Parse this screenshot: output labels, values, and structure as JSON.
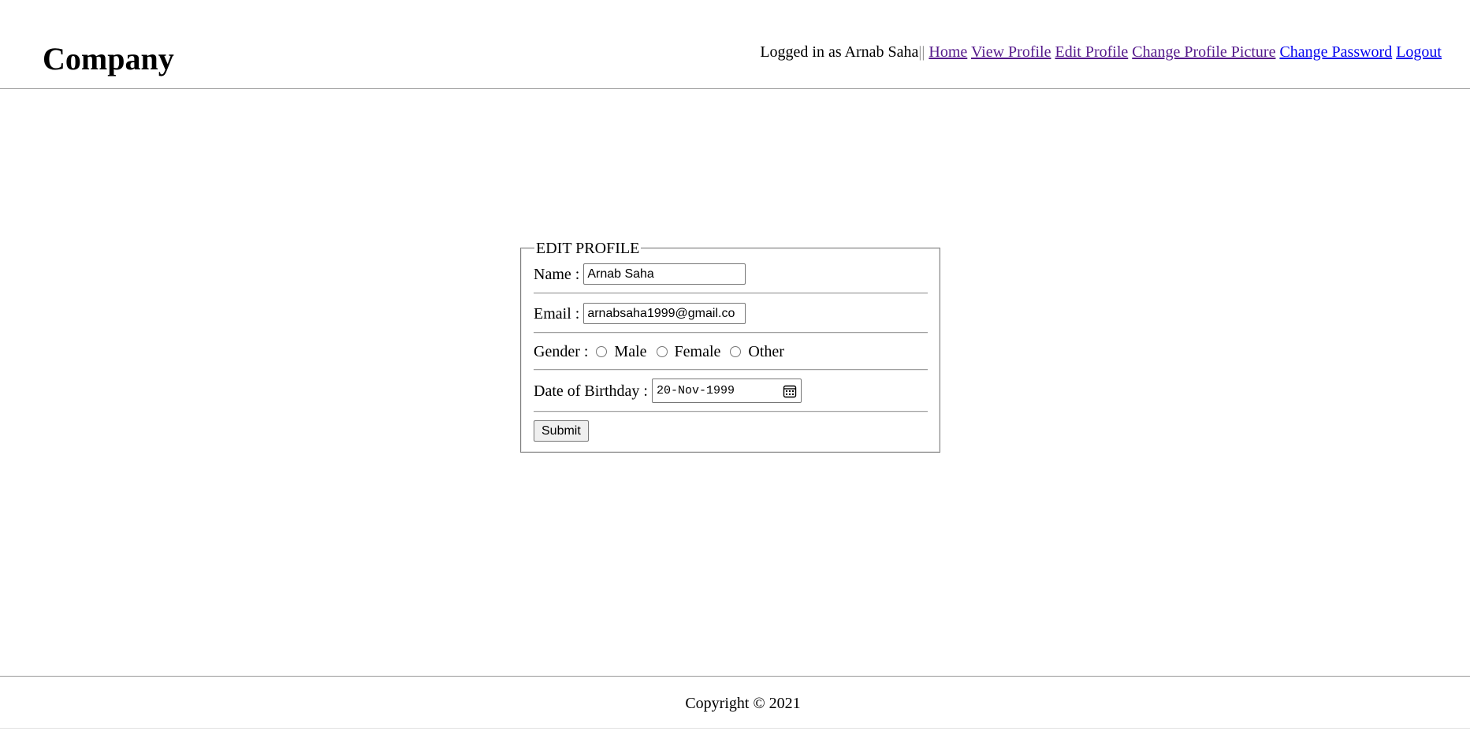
{
  "header": {
    "brand": "Company",
    "logged_in_text": "Logged in as Arnab Saha",
    "separator": "||",
    "nav": [
      {
        "label": "Home"
      },
      {
        "label": "View Profile"
      },
      {
        "label": "Edit Profile"
      },
      {
        "label": "Change Profile Picture"
      },
      {
        "label": "Change Password"
      },
      {
        "label": "Logout"
      }
    ]
  },
  "form": {
    "legend": "EDIT PROFILE",
    "name_label": "Name :",
    "name_value": "Arnab Saha",
    "email_label": "Email :",
    "email_value": "arnabsaha1999@gmail.co",
    "gender_label": "Gender :",
    "gender_options": [
      {
        "label": "Male",
        "checked": false
      },
      {
        "label": "Female",
        "checked": false
      },
      {
        "label": "Other",
        "checked": false
      }
    ],
    "dob_label": "Date of Birthday :",
    "dob_value": "20-Nov-1999",
    "submit_label": "Submit"
  },
  "footer": {
    "copyright": "Copyright © 2021"
  },
  "colors": {
    "link_visited": "#551a8b",
    "link_unvisited": "#0000ee",
    "rule": "#999999"
  },
  "icons": {
    "date_picker": "calendar-icon"
  }
}
